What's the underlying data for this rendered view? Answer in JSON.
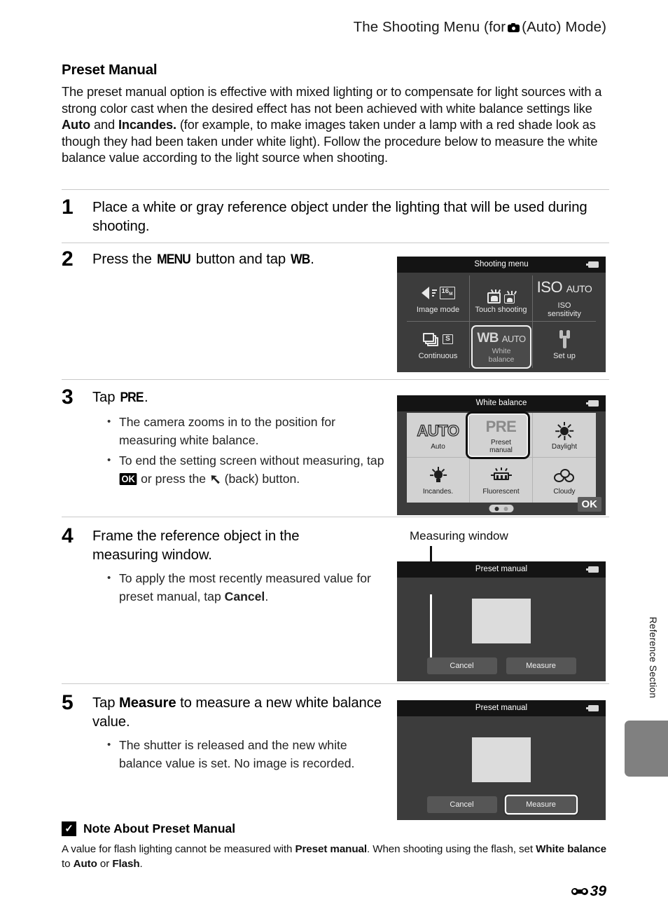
{
  "header": {
    "before_icon": "The Shooting Menu (for",
    "icon": "camera-auto-icon",
    "after_icon": "(Auto) Mode)"
  },
  "section": {
    "title": "Preset Manual",
    "intro_html": "The preset manual option is effective with mixed lighting or to compensate for light sources with a strong color cast when the desired effect has not been achieved with white balance settings like <b>Auto</b> and <b>Incandes.</b> (for example, to make images taken under a lamp with a red shade look as though they had been taken under white light). Follow the procedure below to measure the white balance value according to the light source when shooting."
  },
  "steps": [
    {
      "num": "1",
      "text_html": "Place a white or gray reference object under the lighting that will be used during shooting."
    },
    {
      "num": "2",
      "text_html": "Press the <span class=\"chip-menu\">MENU</span> button and tap <span class=\"chip-wb\">WB</span>."
    },
    {
      "num": "3",
      "text_html": "Tap <span class=\"chip-pre\">PRE</span>.",
      "bullets_html": [
        "The camera zooms in to the position for measuring white balance.",
        "To end the setting screen without measuring, tap <span class=\"chip-ok\">OK</span> or press the <span class=\"chip-back\">&#10138;</span> (back) button."
      ]
    },
    {
      "num": "4",
      "text_html": "Frame the reference object in the measuring window.",
      "bullets_html": [
        "To apply the most recently measured value for preset manual, tap <b>Cancel</b>."
      ]
    },
    {
      "num": "5",
      "text_html": "Tap <b>Measure</b> to measure a new white balance value.",
      "bullets_html": [
        "The shutter is released and the new white balance value is set. No image is recorded."
      ]
    }
  ],
  "shooting_menu_screen": {
    "title": "Shooting menu",
    "battery_icon": "battery-icon",
    "items": [
      {
        "label": "Image mode",
        "icon": "image-mode-icon",
        "badge": "16",
        "badge_sub": "M"
      },
      {
        "label": "Touch shooting",
        "icon": "touch-shooting-icon"
      },
      {
        "label": "ISO\nsensitivity",
        "icon": "iso-icon",
        "value_main": "ISO",
        "value_sub": "AUTO"
      },
      {
        "label": "Continuous",
        "icon": "continuous-icon",
        "badge": "S"
      },
      {
        "label": "White\nbalance",
        "icon": "white-balance-icon",
        "value_main": "WB",
        "value_sub": "AUTO",
        "selected": true
      },
      {
        "label": "Set up",
        "icon": "wrench-icon"
      }
    ],
    "selected_tile": {
      "main": "WB",
      "sub": "AUTO",
      "line1": "White",
      "line2": "balance"
    }
  },
  "white_balance_screen": {
    "title": "White balance",
    "battery_icon": "battery-icon",
    "options": [
      {
        "glyph": "AUTO",
        "label": "Auto",
        "icon": "auto-text-icon"
      },
      {
        "glyph": "PRE",
        "label_line1": "Preset",
        "label_line2": "manual",
        "icon": "preset-manual-icon",
        "selected": true
      },
      {
        "label": "Daylight",
        "icon": "sun-icon"
      },
      {
        "label": "Incandes.",
        "icon": "incandescent-bulb-icon"
      },
      {
        "label": "Fluorescent",
        "icon": "fluorescent-tube-icon"
      },
      {
        "label": "Cloudy",
        "icon": "cloud-icon"
      }
    ],
    "page_dots": {
      "count": 2,
      "active": 1
    },
    "ok_label": "OK"
  },
  "preset_manual_screen_4": {
    "title": "Preset manual",
    "battery_icon": "battery-icon",
    "callout_label": "Measuring window",
    "buttons": [
      {
        "label": "Cancel",
        "selected": false
      },
      {
        "label": "Measure",
        "selected": false
      }
    ]
  },
  "preset_manual_screen_5": {
    "title": "Preset manual",
    "battery_icon": "battery-icon",
    "buttons": [
      {
        "label": "Cancel",
        "selected": false
      },
      {
        "label": "Measure",
        "selected": true
      }
    ]
  },
  "note": {
    "mark": "check-mark-icon",
    "title": "Note About Preset Manual",
    "body_html": "A value for flash lighting cannot be measured with <b>Preset manual</b>. When shooting using the flash, set <b>White balance</b> to <b>Auto</b> or <b>Flash</b>."
  },
  "side_tab": {
    "label": "Reference Section"
  },
  "footer": {
    "icon": "reference-reel-icon",
    "page": "39"
  }
}
